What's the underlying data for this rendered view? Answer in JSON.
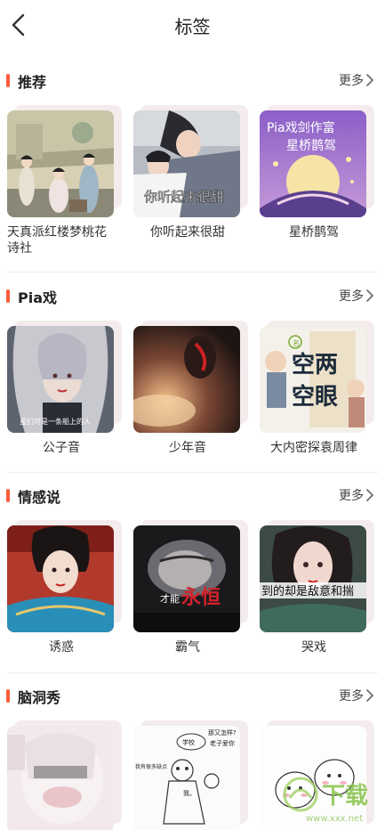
{
  "header": {
    "title": "标签"
  },
  "sections": [
    {
      "title": "推荐",
      "more": "更多",
      "items": [
        {
          "label": "天真派红楼梦桃花诗社"
        },
        {
          "label": "你听起来很甜",
          "overlay": "你听起来很甜"
        },
        {
          "label": "星桥鹊驾",
          "overlay_line1": "Pia戏剑作富",
          "overlay_line2": "星桥鹊驾"
        }
      ]
    },
    {
      "title": "Pia戏",
      "more": "更多",
      "items": [
        {
          "label": "公子音",
          "overlay": "虽们可是一条船上的人"
        },
        {
          "label": "少年音"
        },
        {
          "label": "大内密探袁周律",
          "overlay_line1": "空两",
          "overlay_line2": "空眼",
          "overlay_seal": "名"
        }
      ]
    },
    {
      "title": "情感说",
      "more": "更多",
      "items": [
        {
          "label": "诱惑"
        },
        {
          "label": "霸气",
          "overlay_small": "才能",
          "overlay_big": "永恒"
        },
        {
          "label": "哭戏",
          "overlay": "到的却是敌意和揣"
        }
      ]
    },
    {
      "title": "脑洞秀",
      "more": "更多",
      "items": [
        {
          "label": ""
        },
        {
          "label": "",
          "overlay_1": "学校",
          "overlay_2": "那又怎样?",
          "overlay_3": "老子爱你",
          "overlay_4": "我有很多缺点",
          "overlay_5": "我。"
        },
        {
          "label": ""
        }
      ]
    }
  ],
  "watermark": {
    "text": "下载",
    "sub": "www.xxx.net"
  },
  "colors": {
    "accent": "#ff5a3c",
    "text": "#222222",
    "divider": "#eeeeee"
  }
}
